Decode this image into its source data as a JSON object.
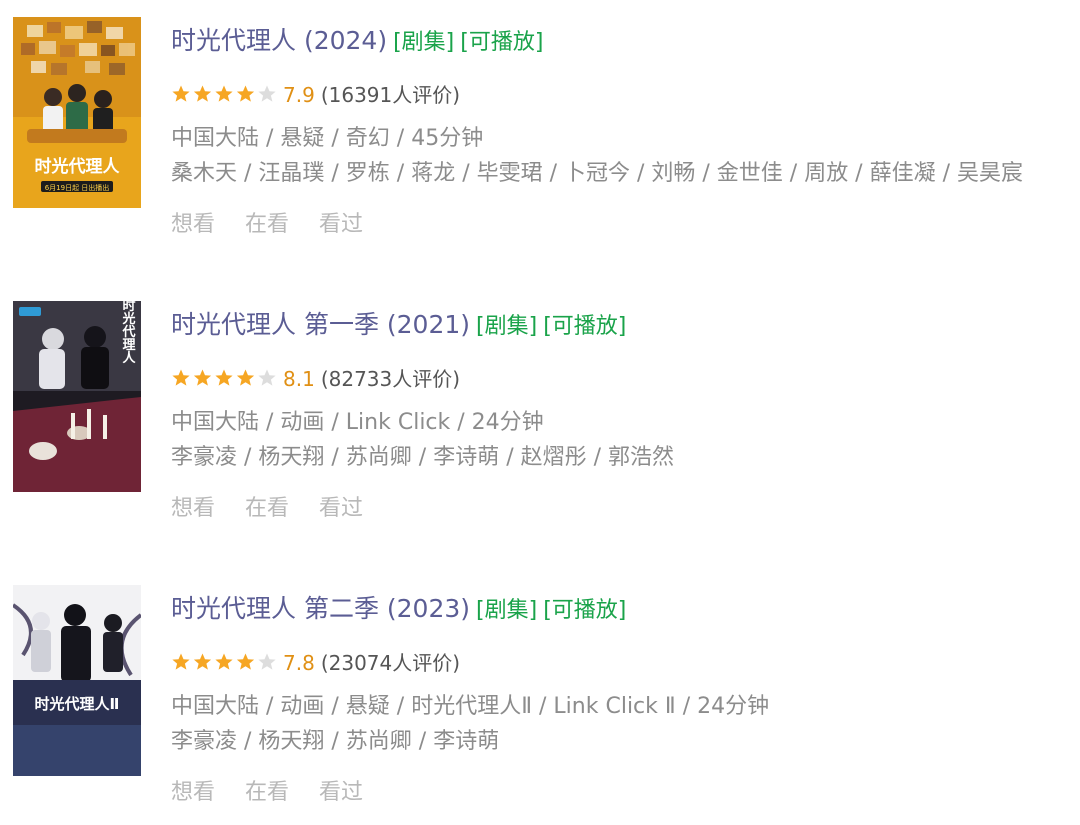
{
  "items": [
    {
      "title": "时光代理人 (2024)",
      "tag_type": "[剧集]",
      "tag_play": "[可播放]",
      "rating": 7.9,
      "score": "7.9",
      "votes": "(16391人评价)",
      "meta": "中国大陆 / 悬疑 / 奇幻 / 45分钟",
      "cast": "桑木天 / 汪晶璞 / 罗栋 / 蒋龙 / 毕雯珺 / 卜冠今 / 刘畅 / 金世佳 / 周放 / 薛佳凝 / 吴昊宸",
      "actions": [
        "想看",
        "在看",
        "看过"
      ],
      "poster": {
        "title_text": "时光代理人",
        "date_text": "6月19日起 日出播出",
        "bg_color": "#e8a51c"
      }
    },
    {
      "title": "时光代理人 第一季 (2021)",
      "tag_type": "[剧集]",
      "tag_play": "[可播放]",
      "rating": 8.1,
      "score": "8.1",
      "votes": "(82733人评价)",
      "meta": "中国大陆 / 动画 / Link Click / 24分钟",
      "cast": "李豪凌 / 杨天翔 / 苏尚卿 / 李诗萌 / 赵熠彤 / 郭浩然",
      "actions": [
        "想看",
        "在看",
        "看过"
      ],
      "poster": {
        "title_text": "时光代理人",
        "bg_color": "#6f2436"
      }
    },
    {
      "title": "时光代理人 第二季 (2023)",
      "tag_type": "[剧集]",
      "tag_play": "[可播放]",
      "rating": 7.8,
      "score": "7.8",
      "votes": "(23074人评价)",
      "meta": "中国大陆 / 动画 / 悬疑 / 时光代理人Ⅱ / Link Click Ⅱ / 24分钟",
      "cast": "李豪凌 / 杨天翔 / 苏尚卿 / 李诗萌",
      "actions": [
        "想看",
        "在看",
        "看过"
      ],
      "poster": {
        "title_text": "时光代理人Ⅱ",
        "bg_color": "#2a3050"
      }
    }
  ],
  "colors": {
    "title": "#5b5d94",
    "tag": "#1aa34a",
    "score": "#e09015",
    "star_on": "#f6a623",
    "star_off": "#dddddd",
    "meta": "#8c8c8c",
    "actions": "#b8b8b8"
  }
}
